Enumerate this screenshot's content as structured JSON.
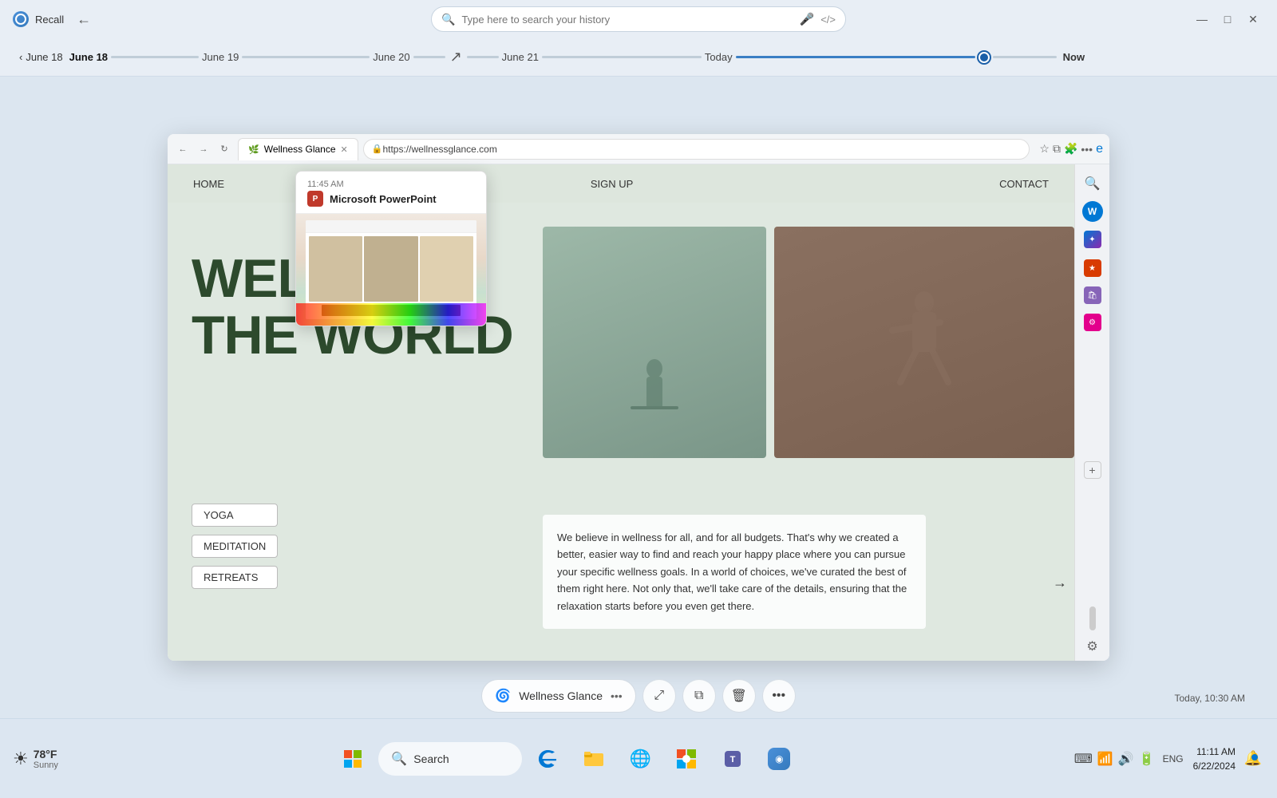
{
  "app": {
    "title": "Recall",
    "icon": "recall-icon"
  },
  "titlebar": {
    "search_placeholder": "Type here to search your history",
    "minimize": "—",
    "maximize": "□",
    "close": "✕"
  },
  "timeline": {
    "back_label": "June 18",
    "items": [
      {
        "label": "June 18",
        "active": true
      },
      {
        "label": "June 19"
      },
      {
        "label": "June 20"
      },
      {
        "label": "June 21"
      },
      {
        "label": "Today"
      },
      {
        "label": "Now"
      }
    ]
  },
  "browser": {
    "url": "https://wellnessglance.com",
    "tab_title": "Wellness Glance"
  },
  "wellness": {
    "nav": {
      "items": [
        "HOME",
        "SIGN UP",
        "CONTACT"
      ]
    },
    "headline_line1": "WELL IN",
    "headline_line2": "THE WORLD",
    "links": [
      "YOGA",
      "MEDITATION",
      "RETREATS"
    ],
    "description": "We believe in wellness for all, and for all budgets. That's why we created a better, easier way to find and reach your happy place where you can pursue your specific wellness goals. In a world of choices, we've curated the best of them right here. Not only that, we'll take care of the details, ensuring that the relaxation starts before you even get there."
  },
  "ppt_popup": {
    "time": "11:45 AM",
    "app_name": "Microsoft PowerPoint",
    "icon_text": "P"
  },
  "bottom_bar": {
    "pill_label": "Wellness Glance",
    "timestamp": "Today, 10:30 AM",
    "expand_icon": "⤢",
    "copy_icon": "⧉",
    "delete_icon": "🗑",
    "more_icon": "•••"
  },
  "taskbar": {
    "weather": {
      "temp": "78°F",
      "desc": "Sunny",
      "icon": "☀"
    },
    "apps": [
      {
        "name": "start-button",
        "icon": "⊞"
      },
      {
        "name": "search-button",
        "icon": "🔍"
      },
      {
        "name": "edge-button",
        "icon": "e"
      },
      {
        "name": "files-button",
        "icon": "📁"
      },
      {
        "name": "browser-button",
        "icon": "🌐"
      },
      {
        "name": "microsoft-store",
        "icon": "🛍"
      },
      {
        "name": "teams-button",
        "icon": "T"
      }
    ],
    "search_text": "Search",
    "sys_time": "11:11 AM",
    "sys_date": "6/22/2024",
    "icons": [
      "🔔",
      "⌨",
      "📶",
      "🔊",
      "🔋"
    ]
  }
}
